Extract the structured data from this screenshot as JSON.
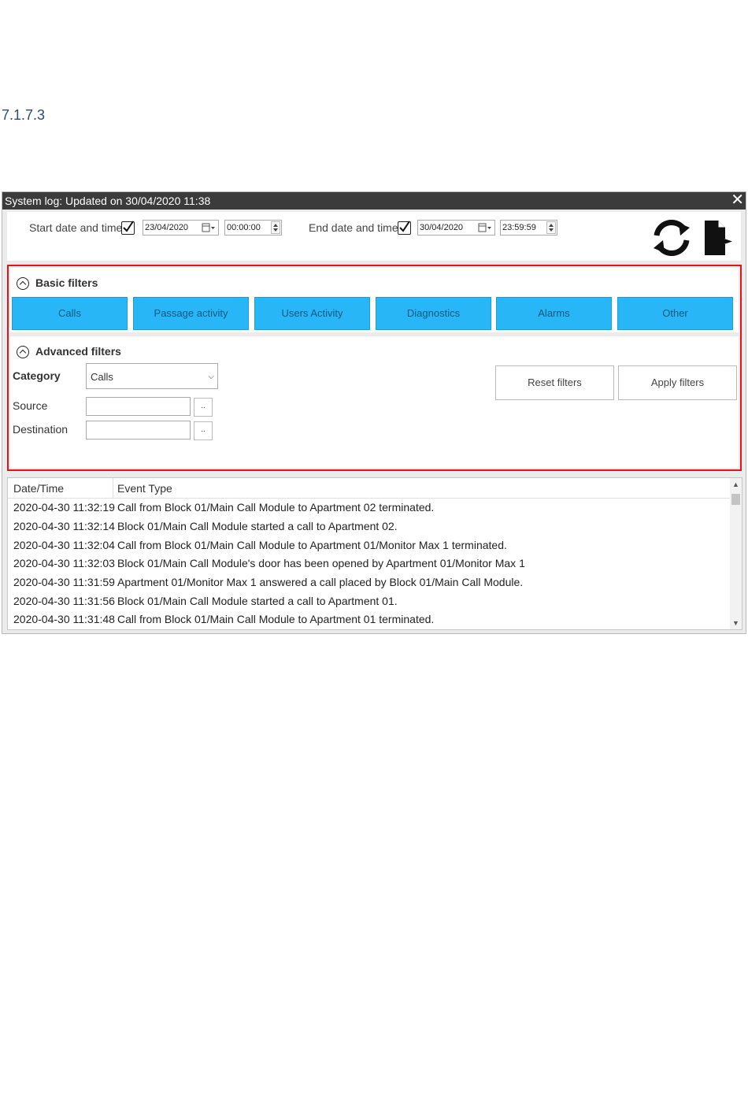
{
  "section_number": "7.1.7.3",
  "window": {
    "title": "System log: Updated on 30/04/2020 11:38",
    "close_glyph": "✕"
  },
  "range": {
    "start_label": "Start date and time",
    "start_checked": true,
    "start_date": "23/04/2020",
    "start_time": "00:00:00",
    "end_label": "End date and time",
    "end_checked": true,
    "end_date": "30/04/2020",
    "end_time": "23:59:59"
  },
  "toolbar_icons": [
    "refresh-icon",
    "export-icon"
  ],
  "basic_filters": {
    "heading": "Basic filters",
    "buttons": [
      "Calls",
      "Passage activity",
      "Users Activity",
      "Diagnostics",
      "Alarms",
      "Other"
    ]
  },
  "advanced_filters": {
    "heading": "Advanced filters",
    "category_label": "Category",
    "category_value": "Calls",
    "source_label": "Source",
    "source_value": "",
    "destination_label": "Destination",
    "destination_value": "",
    "browse_label": "..",
    "reset_label": "Reset filters",
    "apply_label": "Apply filters"
  },
  "log": {
    "columns": [
      "Date/Time",
      "Event Type"
    ],
    "rows": [
      {
        "datetime": "2020-04-30 11:32:19",
        "event": "Call from Block 01/Main Call Module to Apartment 02 terminated."
      },
      {
        "datetime": "2020-04-30 11:32:14",
        "event": "Block 01/Main Call Module started a call to Apartment 02."
      },
      {
        "datetime": "2020-04-30 11:32:04",
        "event": "Call from Block 01/Main Call Module to Apartment 01/Monitor Max 1 terminated."
      },
      {
        "datetime": "2020-04-30 11:32:03",
        "event": "Block 01/Main Call Module's door has been opened by Apartment 01/Monitor Max 1"
      },
      {
        "datetime": "2020-04-30 11:31:59",
        "event": "Apartment 01/Monitor Max 1 answered a call placed by Block 01/Main Call Module."
      },
      {
        "datetime": "2020-04-30 11:31:56",
        "event": "Block 01/Main Call Module started a call to Apartment 01."
      },
      {
        "datetime": "2020-04-30 11:31:48",
        "event": "Call from Block 01/Main Call Module to Apartment 01 terminated."
      }
    ]
  },
  "colors": {
    "titlebar": "#3b3b3b",
    "filter_button": "#29b6f6",
    "highlight_border": "#e0141e"
  }
}
